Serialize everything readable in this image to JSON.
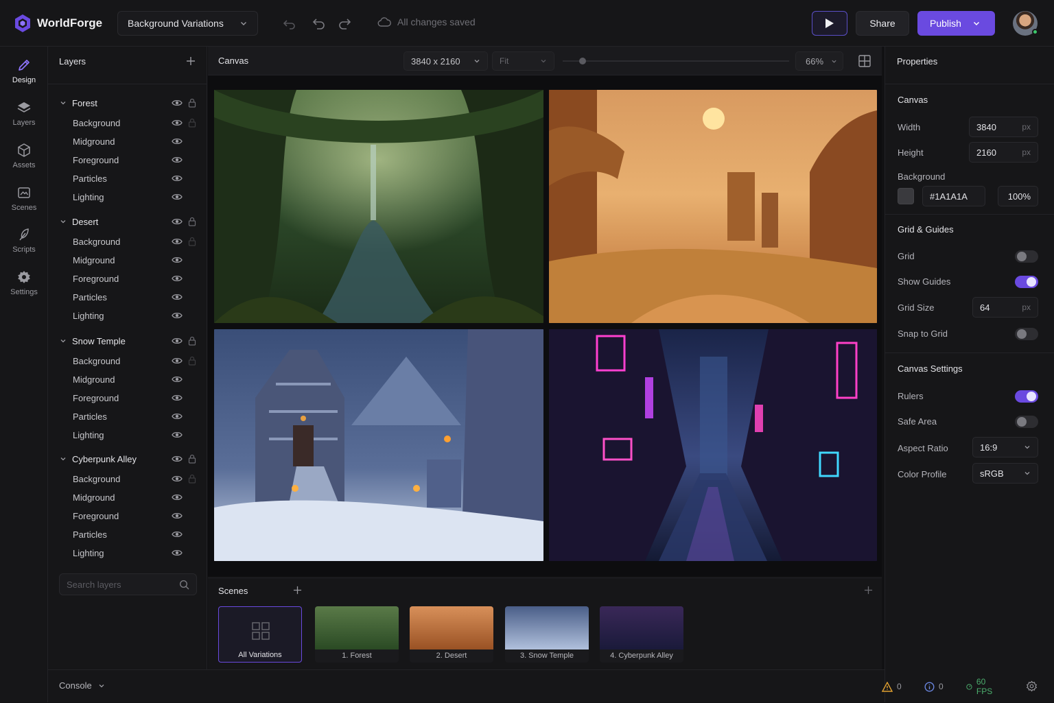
{
  "app": {
    "name": "WorldForge",
    "project": "Background Variations",
    "save_status": "All changes saved"
  },
  "header": {
    "share_label": "Share",
    "publish_label": "Publish"
  },
  "nav": [
    {
      "label": "Design",
      "icon": "pencil-icon"
    },
    {
      "label": "Layers",
      "icon": "layers-icon"
    },
    {
      "label": "Assets",
      "icon": "box-icon"
    },
    {
      "label": "Scenes",
      "icon": "scenes-icon"
    },
    {
      "label": "Scripts",
      "icon": "feather-icon"
    },
    {
      "label": "Settings",
      "icon": "gear-icon"
    }
  ],
  "layers": {
    "title": "Layers",
    "groups": [
      {
        "name": "Forest",
        "children": [
          "Background",
          "Midground",
          "Foreground",
          "Particles",
          "Lighting"
        ]
      },
      {
        "name": "Desert",
        "children": [
          "Background",
          "Midground",
          "Foreground",
          "Particles",
          "Lighting"
        ]
      },
      {
        "name": "Snow Temple",
        "children": [
          "Background",
          "Midground",
          "Foreground",
          "Particles",
          "Lighting"
        ]
      },
      {
        "name": "Cyberpunk Alley",
        "children": [
          "Background",
          "Midground",
          "Foreground",
          "Particles",
          "Lighting"
        ]
      }
    ],
    "search_placeholder": "Search layers"
  },
  "canvas": {
    "title": "Canvas",
    "resolution": "3840 x 2160",
    "fit_label": "Fit",
    "zoom": "66%",
    "zoom_fraction": 0.03
  },
  "scenes": {
    "title": "Scenes",
    "items": [
      "All Variations",
      "1. Forest",
      "2. Desert",
      "3. Snow Temple",
      "4. Cyberpunk Alley"
    ]
  },
  "properties": {
    "title": "Properties",
    "canvas_section": "Canvas",
    "width_label": "Width",
    "width": "3840",
    "height_label": "Height",
    "height": "2160",
    "unit": "px",
    "background_label": "Background",
    "background_hex": "#1A1A1A",
    "background_opacity": "100%",
    "grid_section": "Grid & Guides",
    "grid_label": "Grid",
    "grid_on": false,
    "guides_label": "Show Guides",
    "guides_on": true,
    "grid_size_label": "Grid Size",
    "grid_size": "64",
    "snap_label": "Snap to Grid",
    "snap_on": false,
    "settings_section": "Canvas Settings",
    "rulers_label": "Rulers",
    "rulers_on": true,
    "safe_area_label": "Safe Area",
    "safe_area_on": false,
    "aspect_label": "Aspect Ratio",
    "aspect": "16:9",
    "color_profile_label": "Color Profile",
    "color_profile": "sRGB"
  },
  "footer": {
    "console_label": "Console",
    "warnings": "0",
    "info": "0",
    "fps": "60 FPS"
  },
  "colors": {
    "accent": "#6a4ae0",
    "fps": "#4caf6e",
    "warning": "#e0a030",
    "info": "#6a86e0"
  }
}
